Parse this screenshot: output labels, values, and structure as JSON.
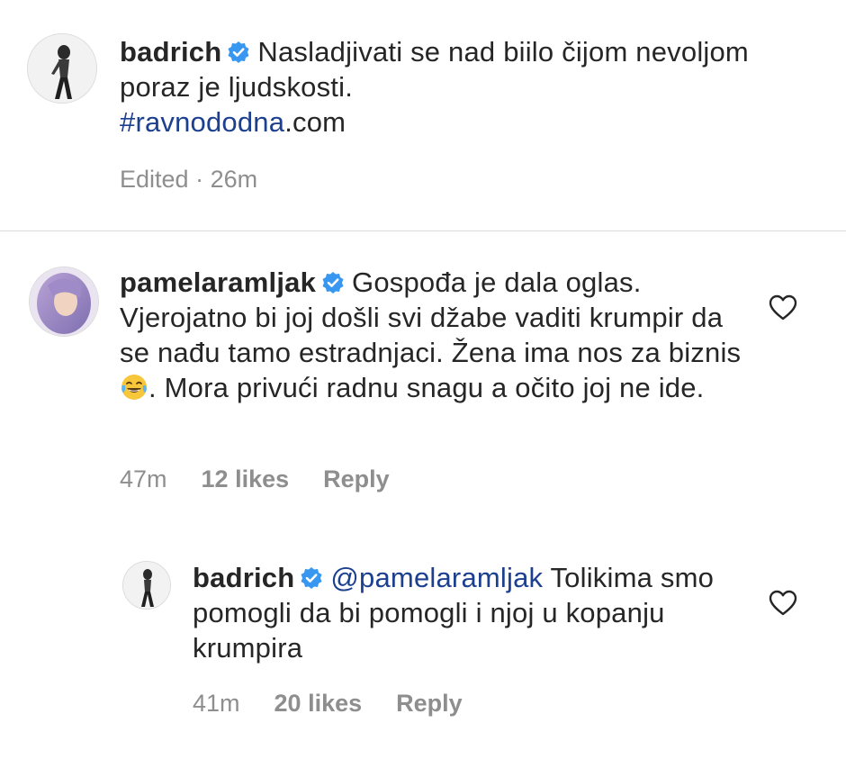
{
  "caption": {
    "username": "badrich",
    "verified_icon": "verified-badge-icon",
    "text": "Nasladjivati se nad biilo čijom nevoljom poraz je ljudskosti.",
    "hashtag": "#ravnododna",
    "hashtag_suffix": ".com",
    "edited_label": "Edited",
    "separator": " · ",
    "time": "26m"
  },
  "comments": [
    {
      "username": "pamelaramljak",
      "text_part1": "Gospođa je dala oglas. Vjerojatno bi joj došli svi džabe vaditi krumpir da se nađu tamo estradnjaci. Žena ima nos za biznis",
      "emoji": "😂",
      "text_part2": ". Mora privući radnu snagu a očito joj ne ide.",
      "time": "47m",
      "likes": "12 likes",
      "reply_label": "Reply",
      "like_icon": "heart-icon"
    },
    {
      "username": "badrich",
      "mention": "@pamelaramljak",
      "text": " Tolikima smo pomogli da bi pomogli i njoj  u kopanju krumpira",
      "time": "41m",
      "likes": "20 likes",
      "reply_label": "Reply",
      "like_icon": "heart-icon"
    }
  ],
  "colors": {
    "text": "#262626",
    "secondary": "#8e8e8e",
    "link": "#1c3f8f",
    "verified": "#3897f0",
    "divider": "#dbdbdb"
  }
}
